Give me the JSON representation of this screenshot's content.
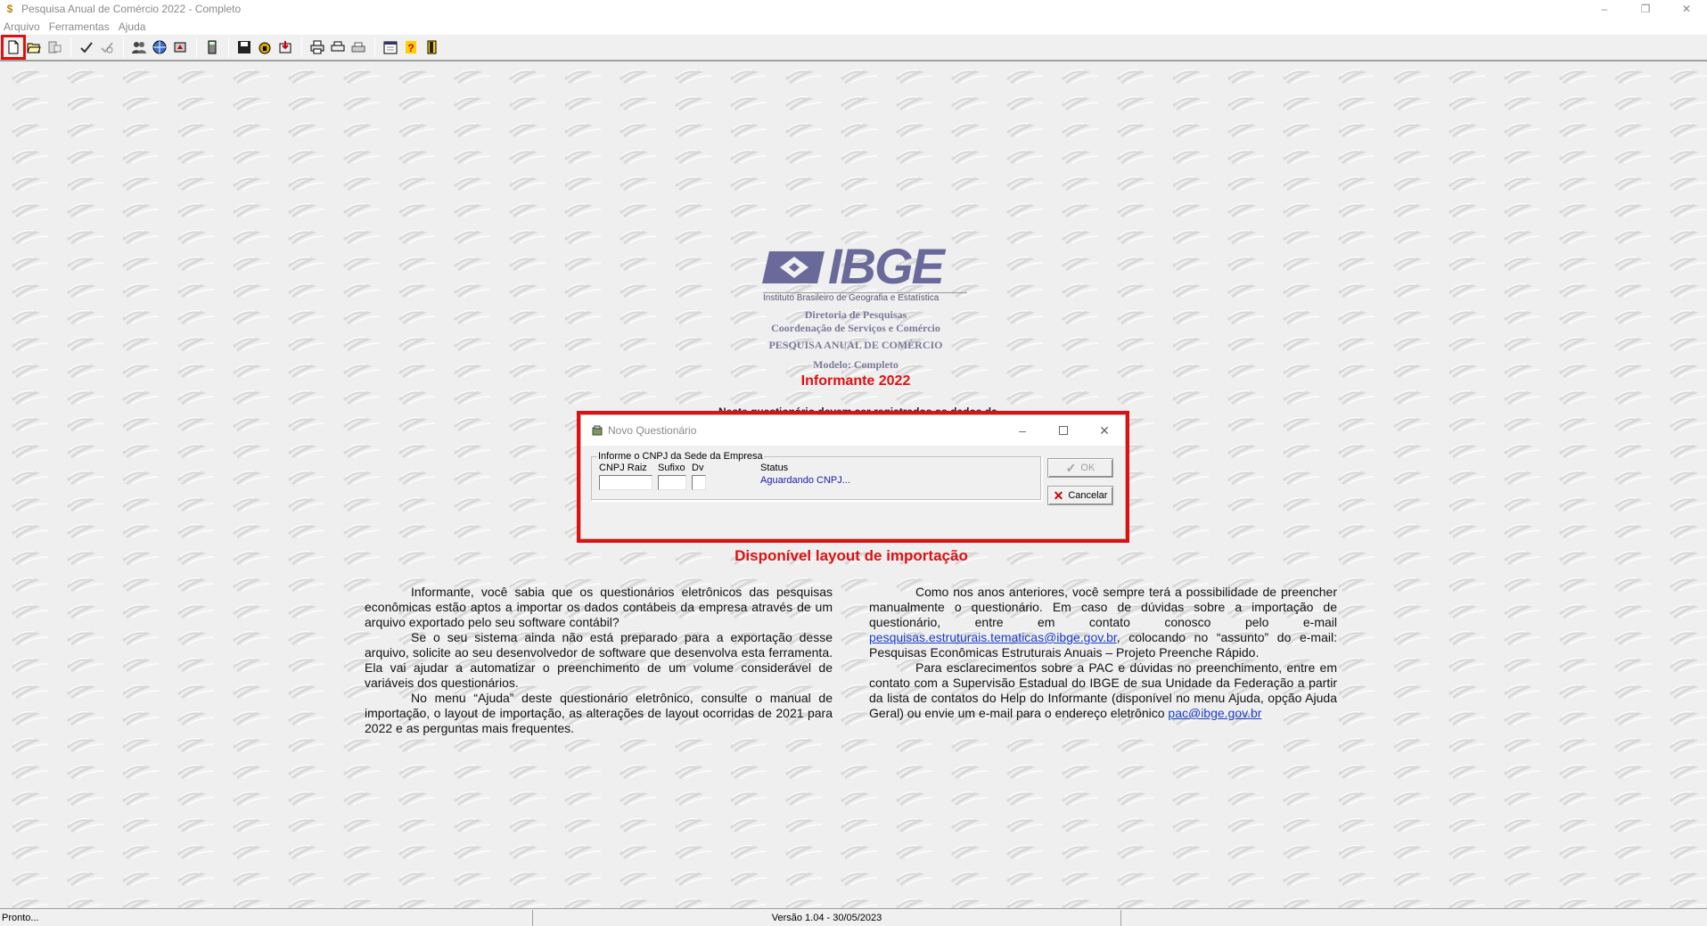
{
  "window": {
    "title": "Pesquisa Anual de Comércio 2022 - Completo",
    "controls": {
      "minimize": "–",
      "restore": "❐",
      "close": "✕"
    }
  },
  "menu": {
    "items": [
      "Arquivo",
      "Ferramentas",
      "Ajuda"
    ]
  },
  "toolbar": {
    "buttons": [
      {
        "icon": "new-document-icon"
      },
      {
        "icon": "open-folder-icon"
      },
      {
        "icon": "export-icon"
      },
      {
        "icon": "check-icon"
      },
      {
        "icon": "verify-icon"
      },
      {
        "icon": "people-icon"
      },
      {
        "icon": "globe-icon"
      },
      {
        "icon": "transmit-icon"
      },
      {
        "icon": "calculator-icon"
      },
      {
        "icon": "save-icon"
      },
      {
        "icon": "lock-icon"
      },
      {
        "icon": "import-icon"
      },
      {
        "icon": "print-icon"
      },
      {
        "icon": "print-preview-icon"
      },
      {
        "icon": "printer-setup-icon"
      },
      {
        "icon": "calendar-icon"
      },
      {
        "icon": "help-icon"
      },
      {
        "icon": "exit-icon"
      }
    ],
    "highlight_color": "#e01010"
  },
  "content": {
    "logo_text": "IBGE",
    "logo_subtitle": "Instituto Brasileiro de Geografia e Estatística",
    "lines": [
      "Diretoria de Pesquisas",
      "Coordenação de Serviços e Comércio",
      "PESQUISA ANUAL DE COMÉRCIO",
      "Modelo: Completo"
    ],
    "informante": "Informante 2022",
    "partial_line": "Neste questionário devem ser registrados os dados da",
    "disponivel": "Disponível layout de importação",
    "left_paragraphs": [
      "Informante, você sabia que os questionários eletrônicos das pesquisas econômicas estão aptos a importar os dados contábeis da empresa através de um arquivo exportado pelo seu software contábil?",
      "Se o seu sistema ainda não está preparado para a exportação desse arquivo, solicite ao seu desenvolvedor de software que desenvolva esta ferramenta. Ela vai ajudar a automatizar o preenchimento de um volume considerável de variáveis dos questionários.",
      "No menu “Ajuda” deste questionário eletrônico, consulte o manual de importação, o layout de importação, as alterações de layout ocorridas de 2021 para 2022 e as perguntas mais frequentes."
    ],
    "right_p1_a": "Como nos anos anteriores, você sempre terá a possibilidade de preencher manualmente o questionário. Em caso de dúvidas sobre a importação de questionário, entre em contato conosco pelo e-mail ",
    "right_p1_link": "pesquisas.estruturais.tematicas@ibge.gov.br",
    "right_p1_b": ", colocando no “assunto” do e-mail: Pesquisas Econômicas Estruturais Anuais – Projeto Preenche Rápido.",
    "right_p2_a": "Para esclarecimentos sobre a PAC e dúvidas no preenchimento, entre em contato com a Supervisão Estadual do IBGE de sua Unidade da Federação a partir da lista de contatos do Help do Informante (disponível no menu Ajuda, opção Ajuda Geral) ou envie um e-mail para o endereço eletrônico ",
    "right_p2_link": "pac@ibge.gov.br"
  },
  "dialog": {
    "title": "Novo Questionário",
    "group_label": "Informe o CNPJ da Sede da Empresa",
    "fields": {
      "cnpj_raiz": {
        "label": "CNPJ Raiz",
        "value": ""
      },
      "sufixo": {
        "label": "Sufixo",
        "value": ""
      },
      "dv": {
        "label": "Dv",
        "value": ""
      }
    },
    "status_label": "Status",
    "status_value": "Aguardando CNPJ...",
    "ok_label": "OK",
    "cancel_label": "Cancelar"
  },
  "statusbar": {
    "left": "Pronto...",
    "version": "Versão 1.04 - 30/05/2023"
  }
}
